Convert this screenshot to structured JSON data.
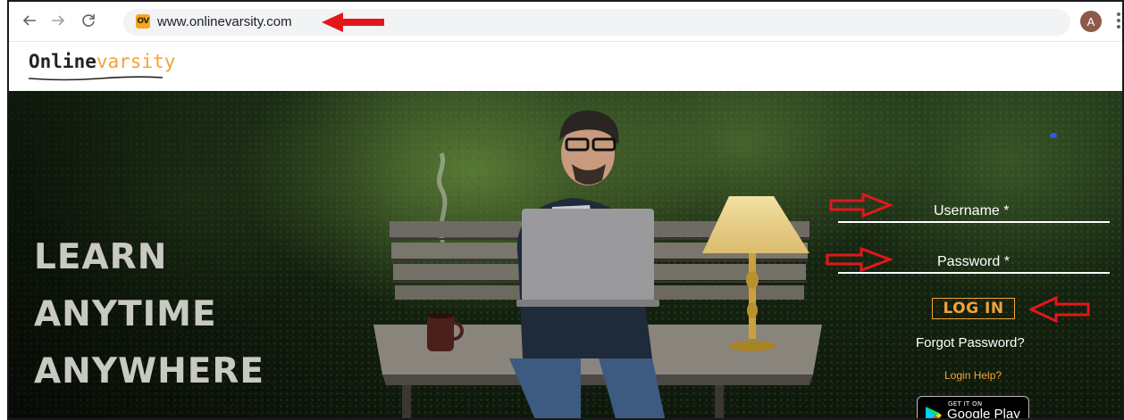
{
  "browser": {
    "url": "www.onlinevarsity.com",
    "favicon_text": "OV",
    "profile_initial": "A",
    "icons": [
      "back-arrow-icon",
      "forward-arrow-icon",
      "reload-icon",
      "menu-dots-icon"
    ]
  },
  "site": {
    "logo_part1": "Online",
    "logo_part2": "varsity"
  },
  "hero": {
    "tagline": [
      "LEARN",
      "ANYTIME",
      "ANYWHERE"
    ]
  },
  "login_form": {
    "username_label": "Username *",
    "password_label": "Password *",
    "login_button": "LOG IN",
    "forgot_password": "Forgot Password?",
    "login_help": "Login Help?",
    "store_badge_small": "GET IT ON",
    "store_badge_big": "Google Play"
  },
  "colors": {
    "accent": "#f2a33a",
    "annotation_red": "#e3171b",
    "text_light": "#c9c9c3"
  }
}
